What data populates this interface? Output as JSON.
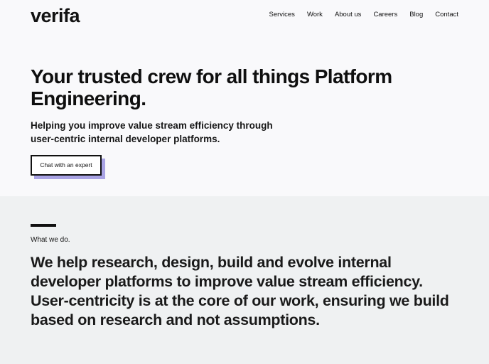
{
  "brand": {
    "logo_text": "verifa"
  },
  "nav": {
    "items": [
      {
        "label": "Services"
      },
      {
        "label": "Work"
      },
      {
        "label": "About us"
      },
      {
        "label": "Careers"
      },
      {
        "label": "Blog"
      },
      {
        "label": "Contact"
      }
    ]
  },
  "hero": {
    "title": "Your trusted crew for all things Platform Engineering.",
    "subtitle": "Helping you improve value stream efficiency through user-centric internal developer platforms.",
    "cta_label": "Chat with an expert"
  },
  "what_we_do": {
    "kicker": "What we do.",
    "statement": "We help research, design, build and evolve internal developer platforms to improve value stream efficiency. User-centricity is at the core of our work, ensuring we build based on research and not assumptions."
  },
  "colors": {
    "hero_bg": "#f9f9fb",
    "section_bg": "#eff1f2",
    "cta_shadow": "#a9a3e4",
    "text": "#111111"
  }
}
